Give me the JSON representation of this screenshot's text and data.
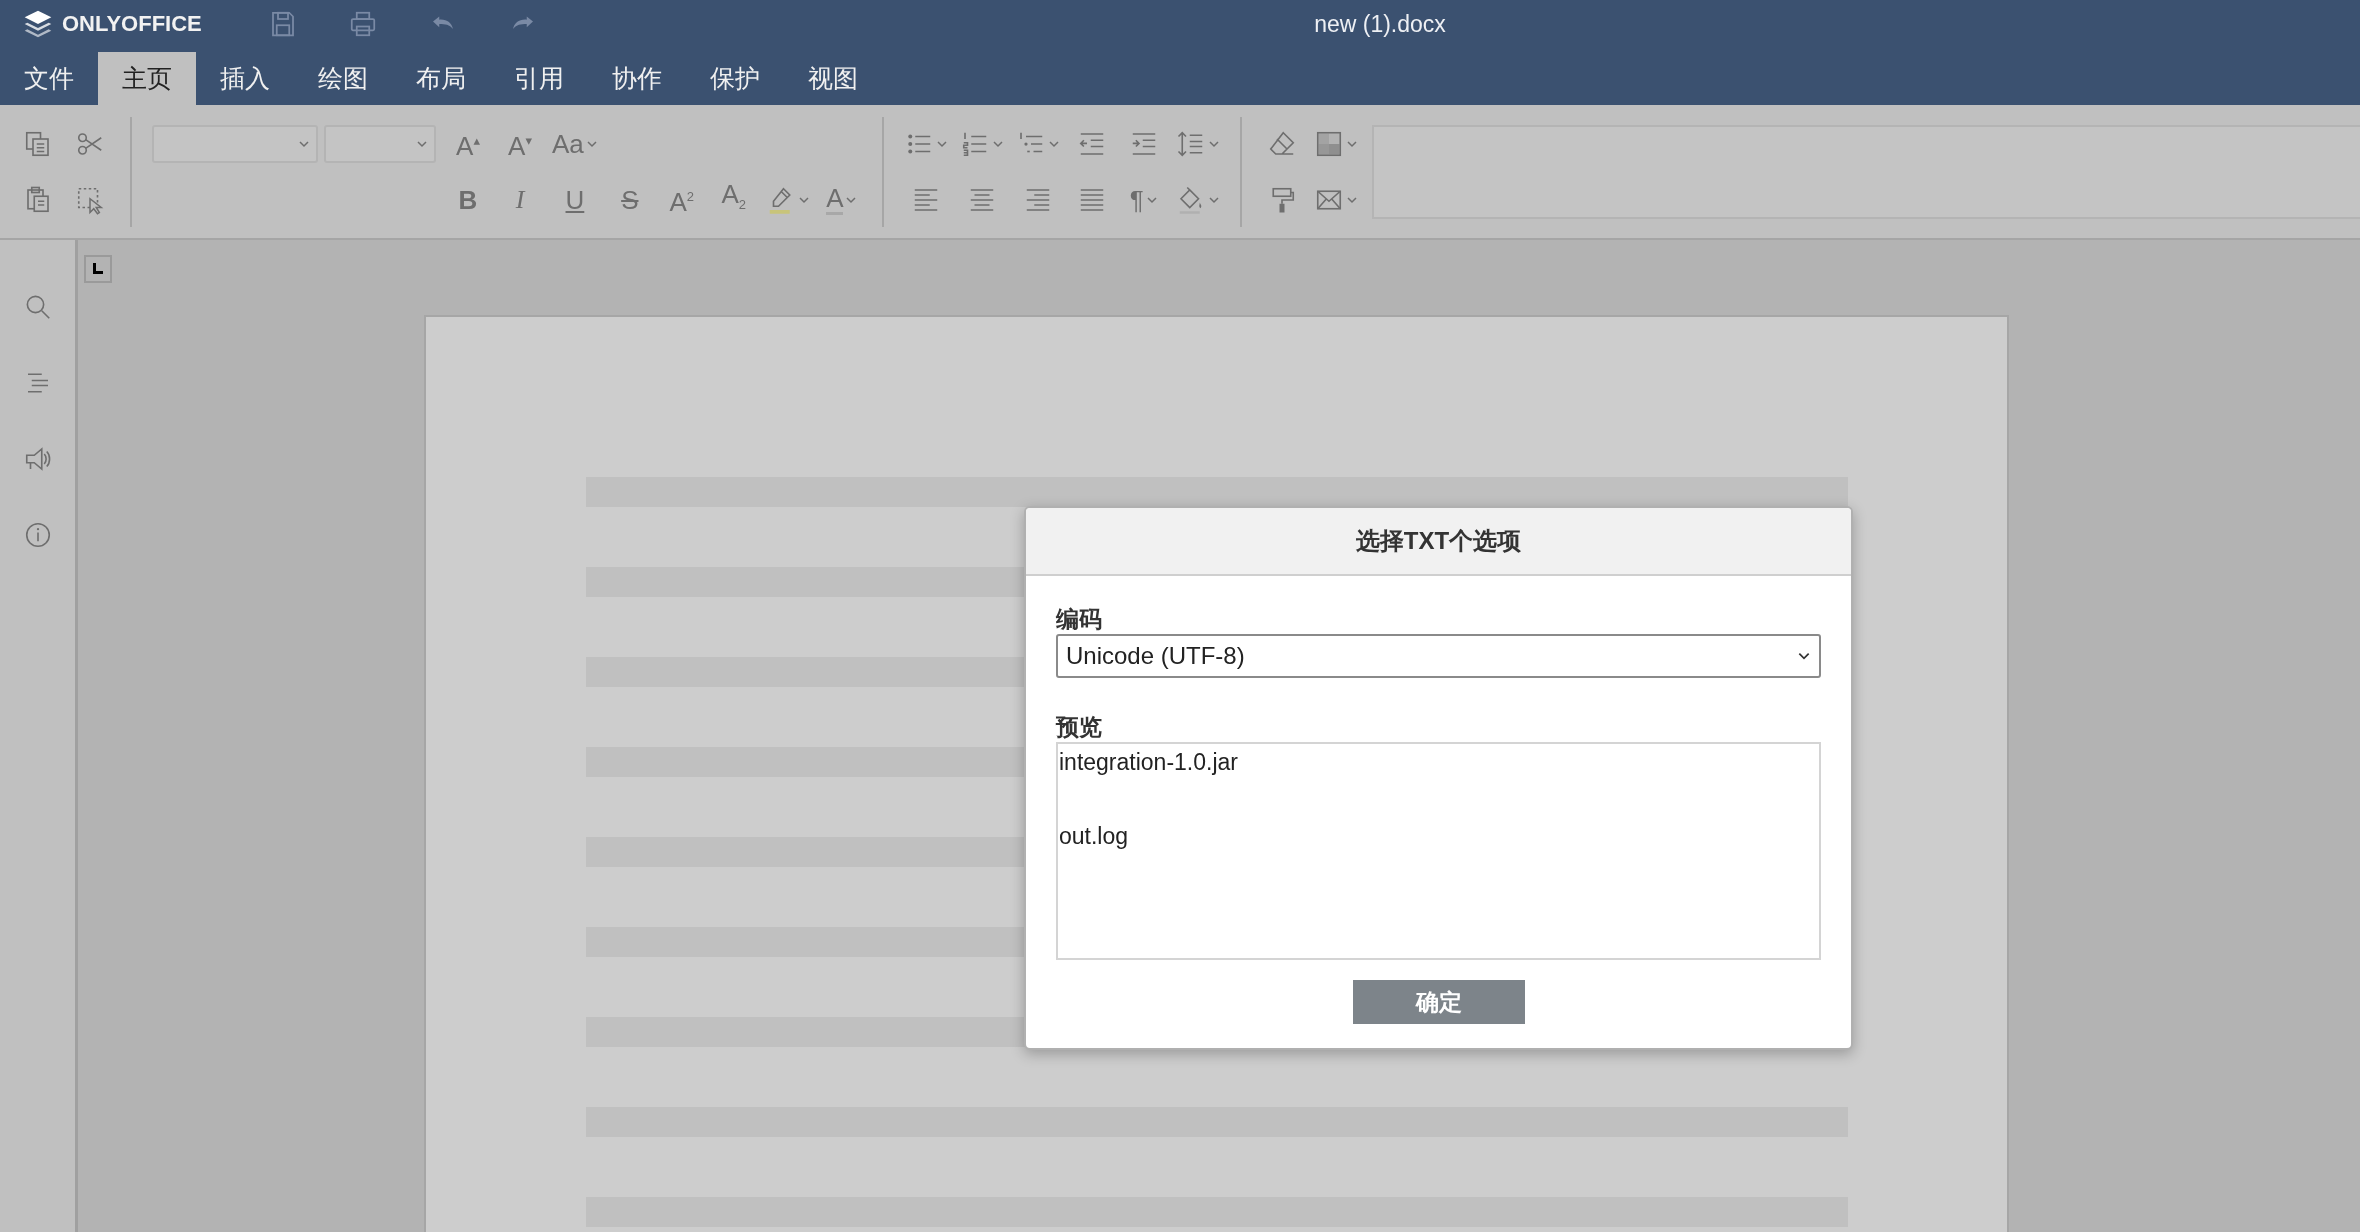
{
  "app": {
    "logo_text": "ONLYOFFICE",
    "document_title": "new (1).docx"
  },
  "menu_tabs": [
    {
      "label": "文件",
      "selected": false
    },
    {
      "label": "主页",
      "selected": true
    },
    {
      "label": "插入",
      "selected": false
    },
    {
      "label": "绘图",
      "selected": false
    },
    {
      "label": "布局",
      "selected": false
    },
    {
      "label": "引用",
      "selected": false
    },
    {
      "label": "协作",
      "selected": false
    },
    {
      "label": "保护",
      "selected": false
    },
    {
      "label": "视图",
      "selected": false
    }
  ],
  "toolbar": {
    "glyphs": [
      "A$^{▴}$",
      "A$^{▾}$",
      "Aa",
      "B",
      "I",
      "U",
      "S",
      "A$^{2}$",
      "A$_{2}$",
      "A",
      "¶"
    ]
  },
  "dialog": {
    "title": "选择TXT个选项",
    "encoding_label": "编码",
    "encoding_value": "Unicode (UTF-8)",
    "preview_label": "预览",
    "preview_text": "integration-1.0.jar\n\nout.log",
    "ok_button": "确定"
  }
}
